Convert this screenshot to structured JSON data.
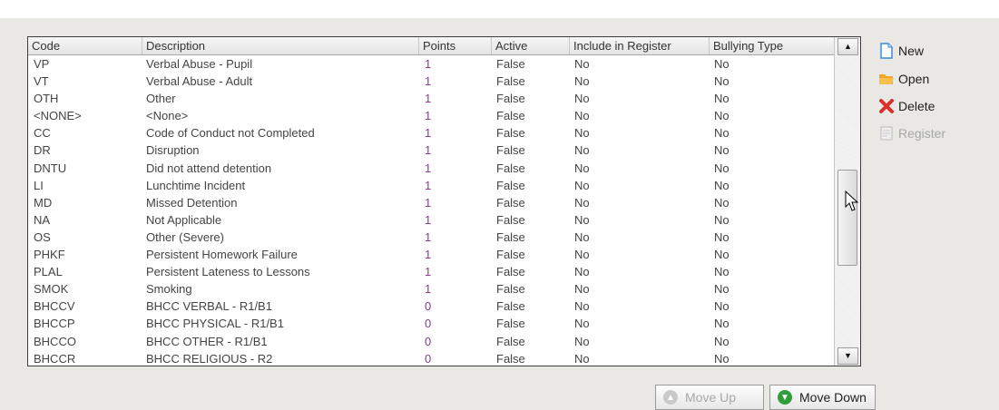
{
  "grid": {
    "columns": [
      "Code",
      "Description",
      "Points",
      "Active",
      "Include in Register",
      "Bullying Type"
    ],
    "rows": [
      [
        "VP",
        "Verbal Abuse - Pupil",
        "1",
        "False",
        "No",
        "No"
      ],
      [
        "VT",
        "Verbal Abuse - Adult",
        "1",
        "False",
        "No",
        "No"
      ],
      [
        "OTH",
        "Other",
        "1",
        "False",
        "No",
        "No"
      ],
      [
        "<NONE>",
        "<None>",
        "1",
        "False",
        "No",
        "No"
      ],
      [
        "CC",
        "Code of Conduct not Completed",
        "1",
        "False",
        "No",
        "No"
      ],
      [
        "DR",
        "Disruption",
        "1",
        "False",
        "No",
        "No"
      ],
      [
        "DNTU",
        "Did not attend detention",
        "1",
        "False",
        "No",
        "No"
      ],
      [
        "LI",
        "Lunchtime Incident",
        "1",
        "False",
        "No",
        "No"
      ],
      [
        "MD",
        "Missed Detention",
        "1",
        "False",
        "No",
        "No"
      ],
      [
        "NA",
        "Not Applicable",
        "1",
        "False",
        "No",
        "No"
      ],
      [
        "OS",
        "Other (Severe)",
        "1",
        "False",
        "No",
        "No"
      ],
      [
        "PHKF",
        "Persistent Homework Failure",
        "1",
        "False",
        "No",
        "No"
      ],
      [
        "PLAL",
        "Persistent Lateness to Lessons",
        "1",
        "False",
        "No",
        "No"
      ],
      [
        "SMOK",
        "Smoking",
        "1",
        "False",
        "No",
        "No"
      ],
      [
        "BHCCV",
        "BHCC VERBAL - R1/B1",
        "0",
        "False",
        "No",
        "No"
      ],
      [
        "BHCCP",
        "BHCC PHYSICAL - R1/B1",
        "0",
        "False",
        "No",
        "No"
      ],
      [
        "BHCCO",
        "BHCC OTHER - R1/B1",
        "0",
        "False",
        "No",
        "No"
      ],
      [
        "BHCCR",
        "BHCC RELIGIOUS - R2",
        "0",
        "False",
        "No",
        "No"
      ]
    ]
  },
  "side_buttons": {
    "new": "New",
    "open": "Open",
    "delete": "Delete",
    "register": "Register"
  },
  "bottom_buttons": {
    "move_up": "Move Up",
    "move_down": "Move Down"
  },
  "colors": {
    "points_text": "#8a3b8f",
    "move_down_icon": "#2e9e3a",
    "delete_icon": "#d9322b",
    "open_icon": "#f0a824",
    "new_icon": "#3d8ad6"
  }
}
